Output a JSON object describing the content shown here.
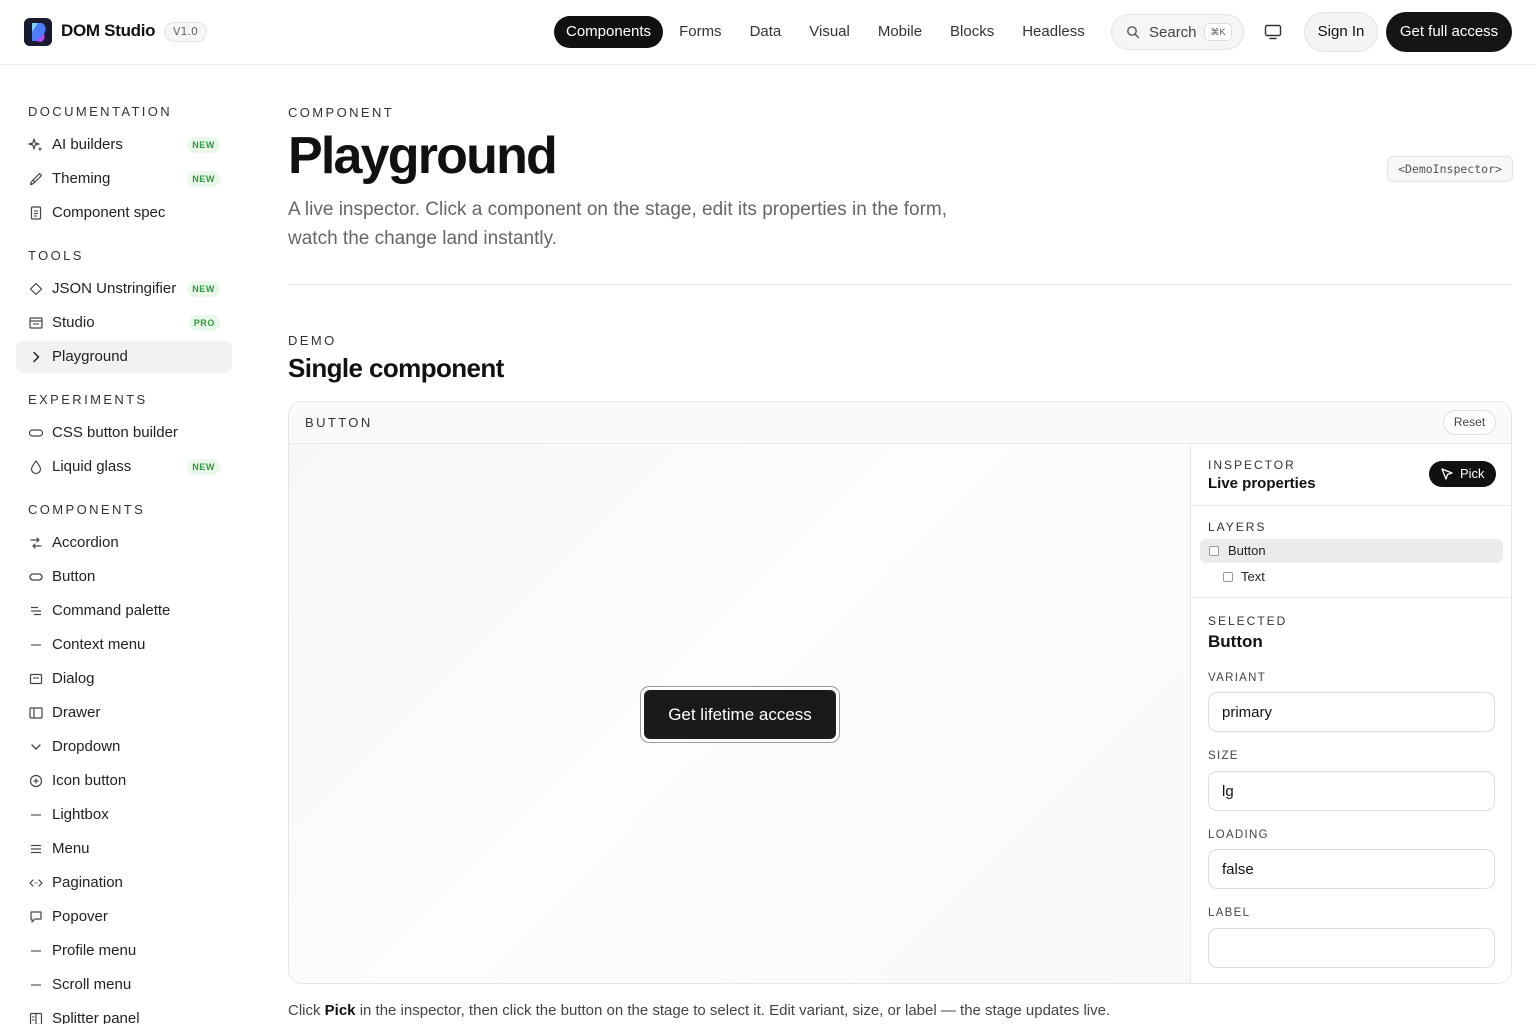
{
  "header": {
    "brand": "DOM Studio",
    "version": "V1.0",
    "nav": [
      "Components",
      "Forms",
      "Data",
      "Visual",
      "Mobile",
      "Blocks",
      "Headless"
    ],
    "active_nav": "Components",
    "search_label": "Search",
    "search_shortcut": "⌘K",
    "signin": "Sign In",
    "cta": "Get full access"
  },
  "sidebar": {
    "documentation": {
      "heading": "DOCUMENTATION",
      "items": [
        {
          "label": "AI builders",
          "icon": "sparkle-icon",
          "badge": "NEW"
        },
        {
          "label": "Theming",
          "icon": "brush-icon",
          "badge": "NEW"
        },
        {
          "label": "Component spec",
          "icon": "document-icon",
          "badge": ""
        }
      ]
    },
    "tools": {
      "heading": "TOOLS",
      "items": [
        {
          "label": "JSON Unstringifier",
          "icon": "diamond-icon",
          "badge": "NEW"
        },
        {
          "label": "Studio",
          "icon": "window-icon",
          "badge": "PRO"
        },
        {
          "label": "Playground",
          "icon": "chevron-right-icon",
          "badge": "",
          "active": true
        }
      ]
    },
    "experiments": {
      "heading": "EXPERIMENTS",
      "items": [
        {
          "label": "CSS button builder",
          "icon": "pill-icon",
          "badge": ""
        },
        {
          "label": "Liquid glass",
          "icon": "drop-icon",
          "badge": "NEW"
        }
      ]
    },
    "components": {
      "heading": "COMPONENTS",
      "items": [
        {
          "label": "Accordion",
          "icon": "accordion-icon"
        },
        {
          "label": "Button",
          "icon": "button-icon"
        },
        {
          "label": "Command palette",
          "icon": "command-icon"
        },
        {
          "label": "Context menu",
          "icon": "dash-icon"
        },
        {
          "label": "Dialog",
          "icon": "dialog-icon"
        },
        {
          "label": "Drawer",
          "icon": "drawer-icon"
        },
        {
          "label": "Dropdown",
          "icon": "chevron-down-icon"
        },
        {
          "label": "Icon button",
          "icon": "plus-circle-icon"
        },
        {
          "label": "Lightbox",
          "icon": "dash-icon"
        },
        {
          "label": "Menu",
          "icon": "menu-icon"
        },
        {
          "label": "Pagination",
          "icon": "arrows-icon"
        },
        {
          "label": "Popover",
          "icon": "popover-icon"
        },
        {
          "label": "Profile menu",
          "icon": "dash-icon"
        },
        {
          "label": "Scroll menu",
          "icon": "dash-icon"
        },
        {
          "label": "Splitter panel",
          "icon": "splitter-icon"
        }
      ]
    }
  },
  "main": {
    "eyebrow": "COMPONENT",
    "title": "Playground",
    "lead": "A live inspector. Click a component on the stage, edit its properties in the form, watch the change land instantly.",
    "code_chip": "<DemoInspector>",
    "demo_eyebrow": "DEMO",
    "demo_title": "Single component",
    "panel": {
      "title": "BUTTON",
      "reset": "Reset",
      "stage_button": "Get lifetime access",
      "inspector": {
        "label": "INSPECTOR",
        "subtitle": "Live properties",
        "pick": "Pick",
        "layers_label": "LAYERS",
        "layers": [
          "Button",
          "Text"
        ],
        "selected_label": "SELECTED",
        "selected": "Button",
        "fields": [
          {
            "label": "VARIANT",
            "value": "primary"
          },
          {
            "label": "SIZE",
            "value": "lg"
          },
          {
            "label": "LOADING",
            "value": "false"
          },
          {
            "label": "LABEL",
            "value": ""
          }
        ]
      }
    },
    "footnote": {
      "before": "Click ",
      "bold": "Pick",
      "after": " in the inspector, then click the button on the stage to select it. Edit variant, size, or label — the stage updates live."
    }
  },
  "colors": {
    "accent": "#111111",
    "badge_bg": "#e9f8ea",
    "badge_text": "#2f9a3b"
  }
}
